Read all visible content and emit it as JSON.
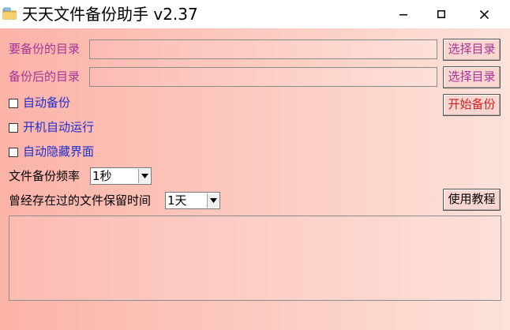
{
  "window": {
    "title": "天天文件备份助手 v2.37",
    "controls": {
      "minimize": "–",
      "maximize": "□",
      "close": "✕"
    }
  },
  "source": {
    "label": "要备份的目录",
    "value": "",
    "button": "选择目录"
  },
  "target": {
    "label": "备份后的目录",
    "value": "",
    "button": "选择目录"
  },
  "options": [
    {
      "label": "自动备份",
      "checked": false
    },
    {
      "label": "开机自动运行",
      "checked": false
    },
    {
      "label": "自动隐藏界面",
      "checked": false
    }
  ],
  "start_button": "开始备份",
  "frequency": {
    "label": "文件备份频率",
    "value": "1秒"
  },
  "retention": {
    "label": "曾经存在过的文件保留时间",
    "value": "1天"
  },
  "tutorial_button": "使用教程",
  "log": {
    "value": ""
  },
  "colors": {
    "label_purple": "#a8339a",
    "label_blue": "#1f2ed0",
    "start_red": "#d42020",
    "bg_left": "#fcb3a8",
    "bg_right": "#fde2da"
  },
  "icons": {
    "app": "folder-icon",
    "dropdown": "chevron-down-icon"
  }
}
